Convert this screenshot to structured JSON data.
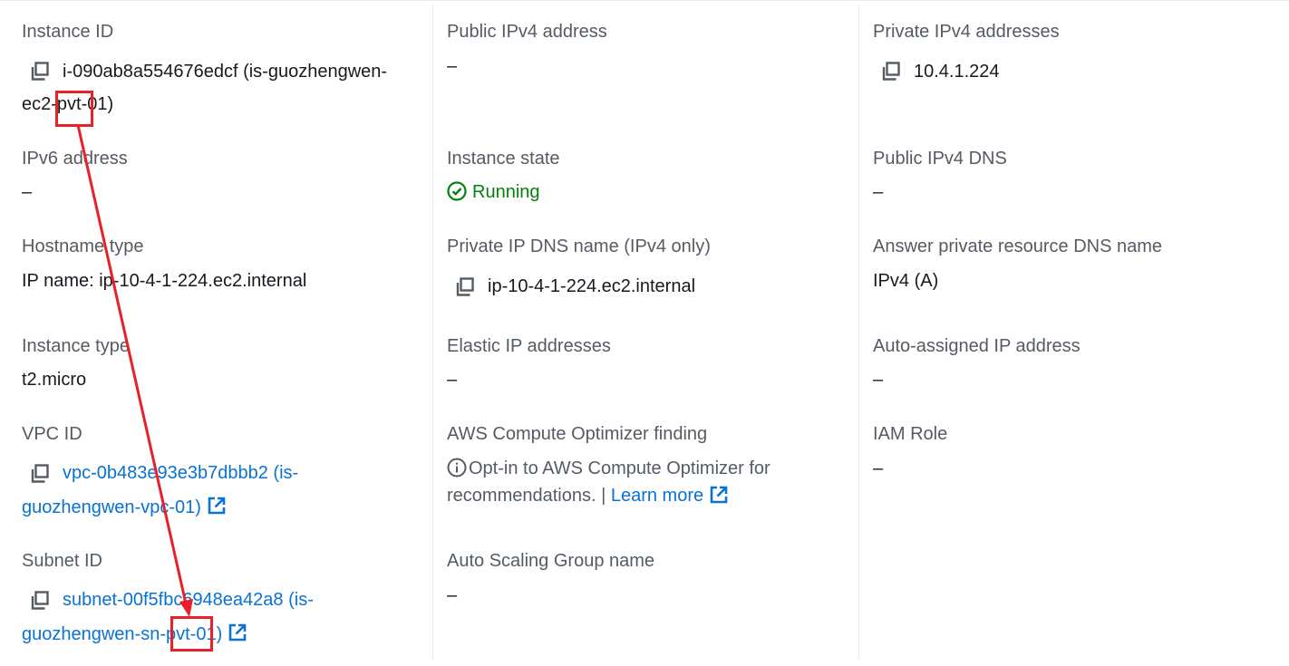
{
  "col1": {
    "instance_id": {
      "label": "Instance ID",
      "line1": "i-090ab8a554676edcf (is-guozhengwen-",
      "line2": "ec2-pvt-01)"
    },
    "ipv6": {
      "label": "IPv6 address",
      "value": "–"
    },
    "hostname_type": {
      "label": "Hostname type",
      "value": "IP name: ip-10-4-1-224.ec2.internal"
    },
    "instance_type": {
      "label": "Instance type",
      "value": "t2.micro"
    },
    "vpc_id": {
      "label": "VPC ID",
      "line1": "vpc-0b483e93e3b7dbbb2 (is-",
      "line2": "guozhengwen-vpc-01)"
    },
    "subnet_id": {
      "label": "Subnet ID",
      "line1": "subnet-00f5fbc6948ea42a8 (is-",
      "line2": "guozhengwen-sn-pvt-01)"
    }
  },
  "col2": {
    "public_ipv4": {
      "label": "Public IPv4 address",
      "value": "–"
    },
    "instance_state": {
      "label": "Instance state",
      "value": "Running"
    },
    "private_dns": {
      "label": "Private IP DNS name (IPv4 only)",
      "value": "ip-10-4-1-224.ec2.internal"
    },
    "elastic_ip": {
      "label": "Elastic IP addresses",
      "value": "–"
    },
    "optimizer": {
      "label": "AWS Compute Optimizer finding",
      "text_line1": "Opt-in to AWS Compute Optimizer for",
      "text_line2": "recommendations. |",
      "link": "Learn more"
    },
    "asg": {
      "label": "Auto Scaling Group name",
      "value": "–"
    }
  },
  "col3": {
    "private_ipv4": {
      "label": "Private IPv4 addresses",
      "value": "10.4.1.224"
    },
    "public_dns": {
      "label": "Public IPv4 DNS",
      "value": "–"
    },
    "answer_dns": {
      "label": "Answer private resource DNS name",
      "value": "IPv4 (A)"
    },
    "auto_ip": {
      "label": "Auto-assigned IP address",
      "value": "–"
    },
    "iam_role": {
      "label": "IAM Role",
      "value": "–"
    }
  },
  "colors": {
    "link": "#0972d3",
    "running": "#037f0c",
    "annotation": "#e8202a",
    "label": "#545b64"
  }
}
